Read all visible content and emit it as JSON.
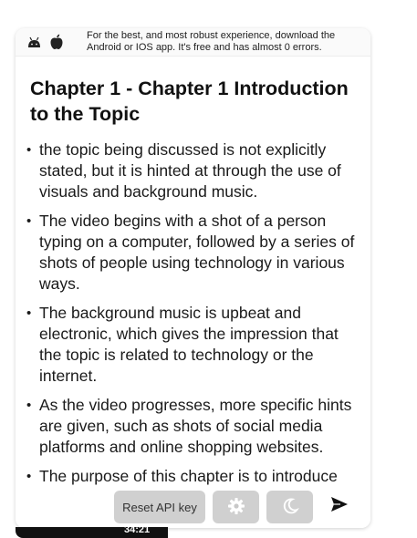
{
  "banner": {
    "message": "For the best, and most robust experience, download the Android or IOS app. It's free and has almost 0 errors.",
    "icons": [
      "android-icon",
      "apple-icon"
    ]
  },
  "chapter": {
    "title": "Chapter 1 - Chapter 1 Introduction to the Topic",
    "bullets": [
      "the topic being discussed is not explicitly stated, but it is hinted at through the use of visuals and background music.",
      "The video begins with a shot of a person typing on a computer, followed by a series of shots of people using technology in various ways.",
      "The background music is upbeat and electronic, which gives the impression that the topic is related to technology or the internet.",
      "As the video progresses, more specific hints are given, such as shots of social media platforms and online shopping websites.",
      "The purpose of this chapter is to introduce"
    ]
  },
  "toolbar": {
    "reset_label": "Reset API key",
    "settings_icon": "gear-icon",
    "theme_icon": "moon-icon",
    "send_icon": "send-icon"
  },
  "video": {
    "timestamp": "34:21"
  },
  "colors": {
    "toolbar_button_bg": "#c8c8c8",
    "text": "#1a1a1a",
    "video_bar": "#111111"
  }
}
